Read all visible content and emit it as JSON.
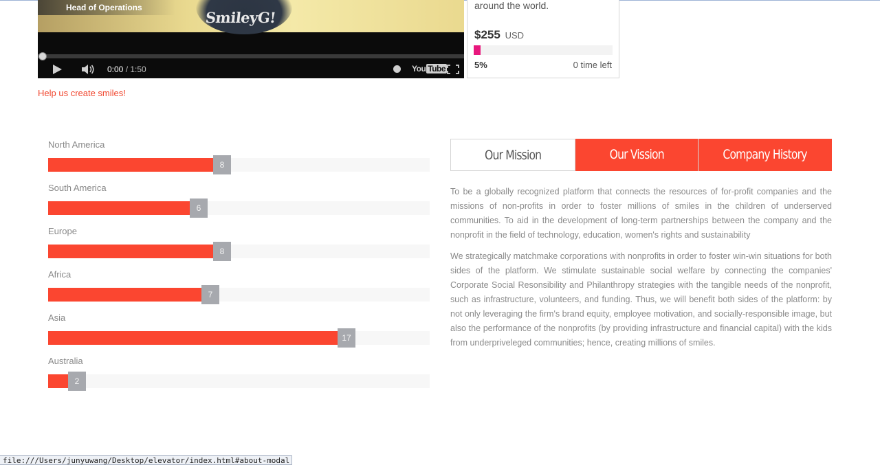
{
  "video": {
    "caption": "Head of Operations",
    "shirt_text": "SmileyG!",
    "current_time": "0:00",
    "time_separator": " / ",
    "duration": "1:50",
    "progress_fraction": 0.0,
    "youtube_brand": "You",
    "youtube_brand_box": "Tube"
  },
  "funding": {
    "tagline": "around the world.",
    "amount": "$255",
    "currency": "USD",
    "percent_label": "5%",
    "percent_value": 0.05,
    "time_left": "0 time left",
    "accent_color": "#e8177d"
  },
  "help_link": "Help us create smiles!",
  "regions": {
    "max_value": 17,
    "accent_color": "#fb4630",
    "items": [
      {
        "label": "North America",
        "value": 8,
        "badge": "8",
        "fill_fraction": 0.432
      },
      {
        "label": "South America",
        "value": 6,
        "badge": "6",
        "fill_fraction": 0.371
      },
      {
        "label": "Europe",
        "value": 8,
        "badge": "8",
        "fill_fraction": 0.432
      },
      {
        "label": "Africa",
        "value": 7,
        "badge": "7",
        "fill_fraction": 0.402
      },
      {
        "label": "Asia",
        "value": 17,
        "badge": "17",
        "fill_fraction": 0.759
      },
      {
        "label": "Australia",
        "value": 2,
        "badge": "2",
        "fill_fraction": 0.052
      }
    ]
  },
  "tabs": [
    {
      "label": "Our Mission",
      "active": false
    },
    {
      "label": "Our Vission",
      "active": true
    },
    {
      "label": "Company History",
      "active": true
    }
  ],
  "content": {
    "paragraph_1": "To be a globally recognized platform that connects the resources of for-profit companies and the missions of non-profits in order to foster millions of smiles in the children of underserved communities. To aid in the development of long-term partnerships between the company and the nonprofit in the field of technology, education, women's rights and sustainability",
    "paragraph_2": "We strategically matchmake corporations with nonprofits in order to foster win-win situations for both sides of the platform. We stimulate sustainable social welfare by connecting the companies' Corporate Social Resonsibility and Philanthropy strategies with the tangible needs of the nonprofit, such as infrastructure, volunteers, and funding. Thus, we will benefit both sides of the platform: by not only leveraging the firm's brand equity, employee motivation, and socially-responsible image, but also the performance of the nonprofits (by providing infrastructure and financial capital) with the kids from underpriveleged communities; hence, creating millions of smiles."
  },
  "status_bar": "file:///Users/junyuwang/Desktop/elevator/index.html#about-modal"
}
